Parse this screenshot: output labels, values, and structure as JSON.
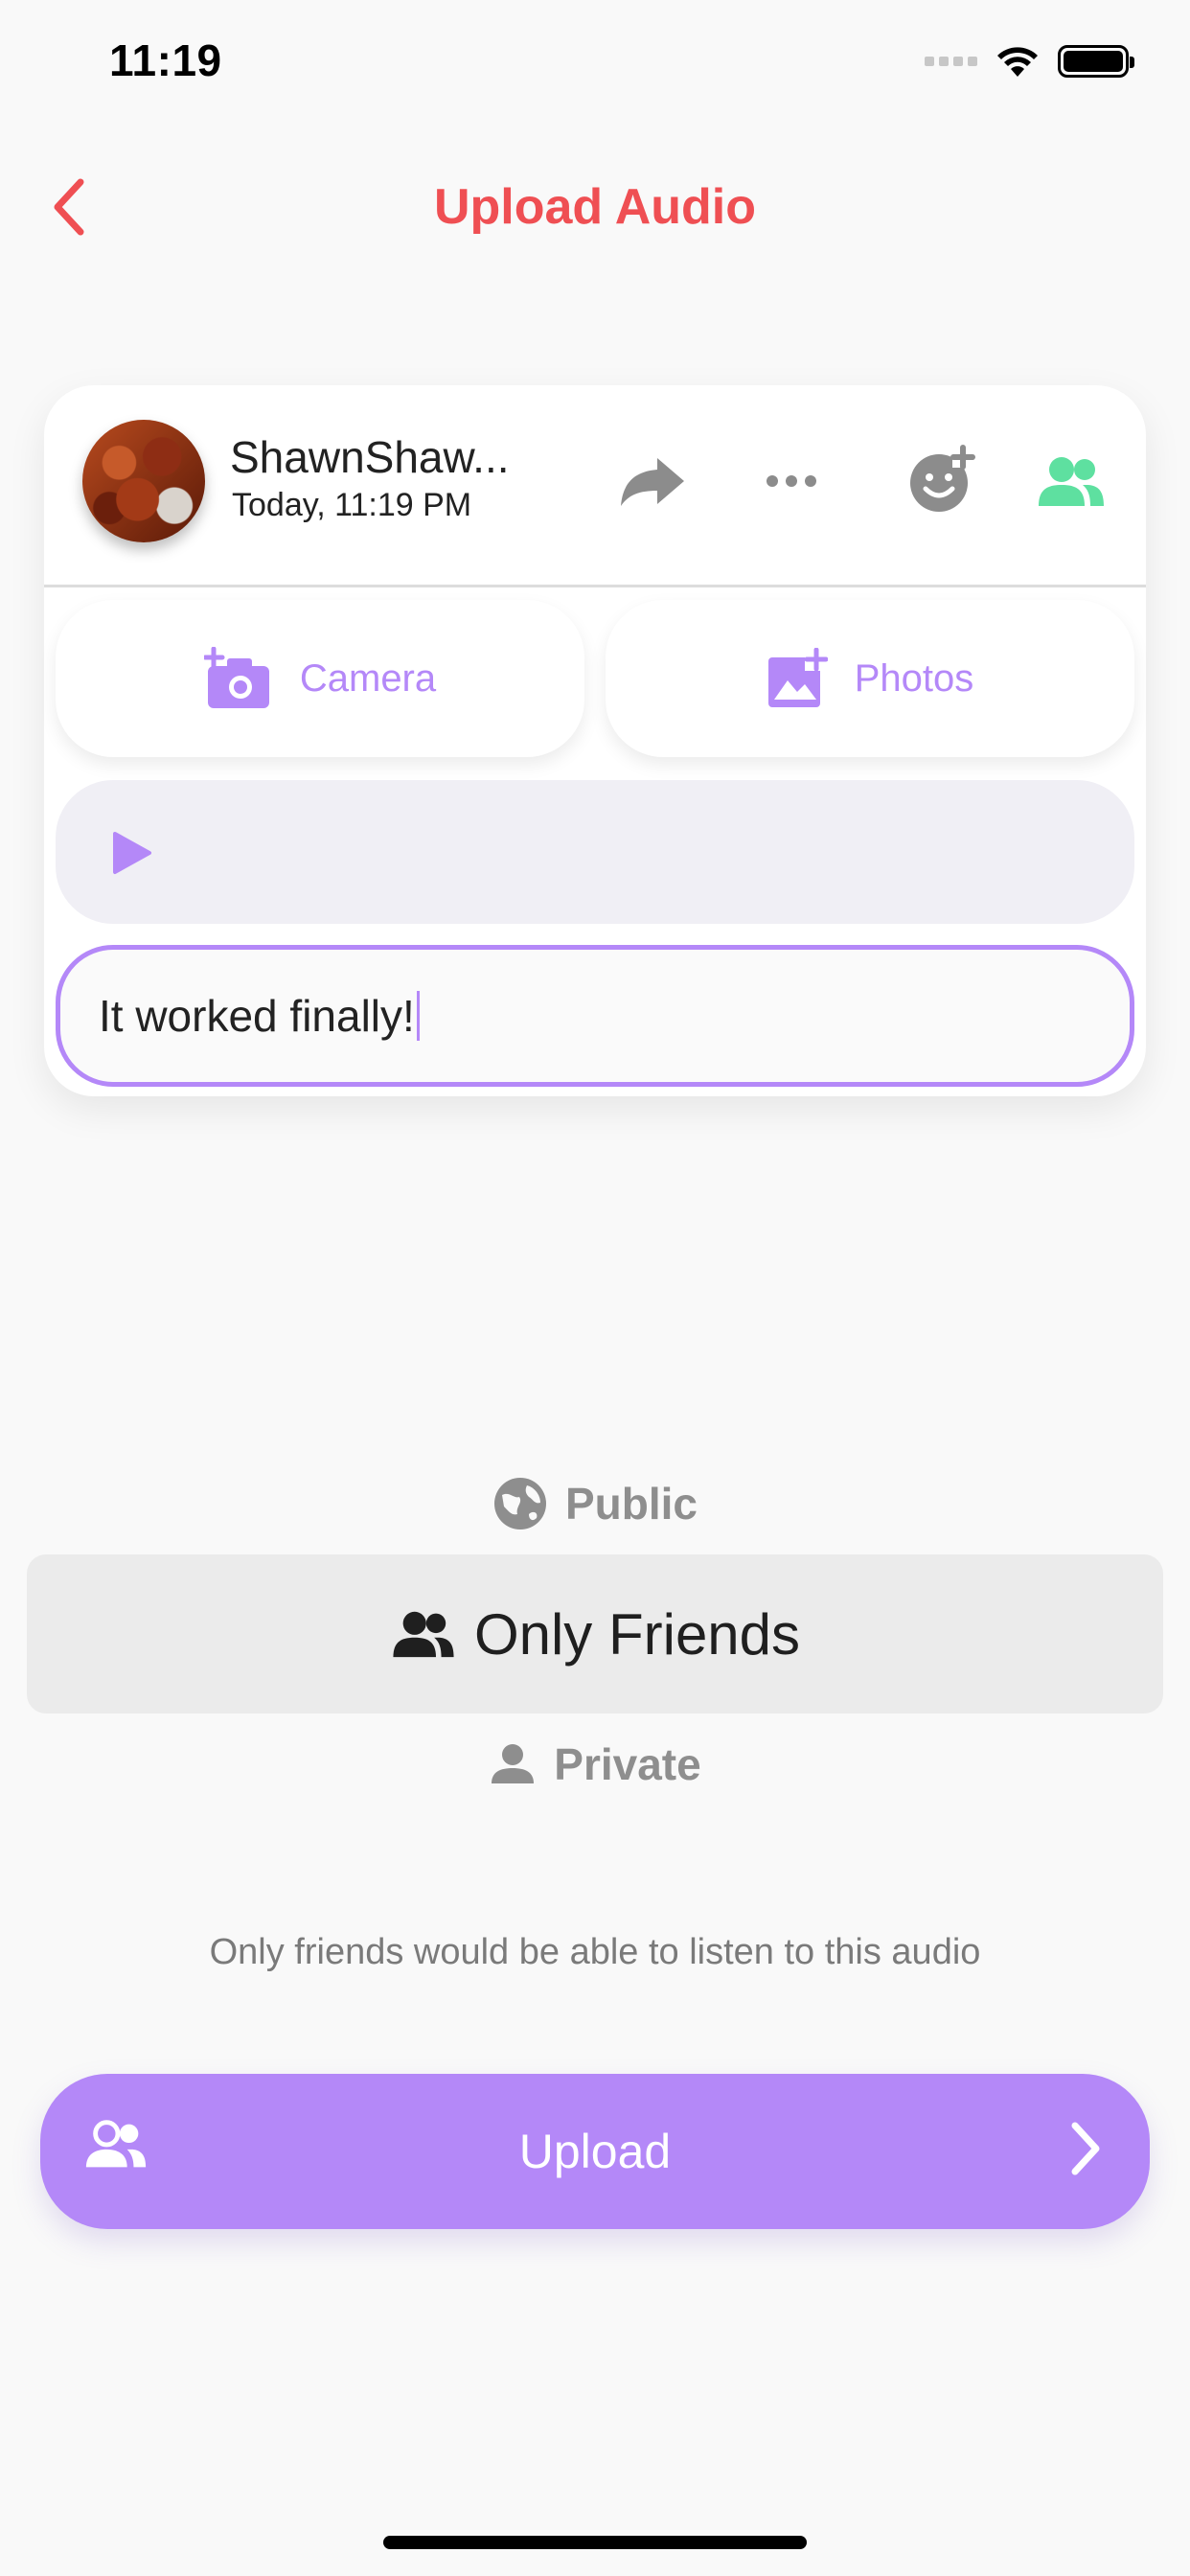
{
  "status_bar": {
    "time": "11:19"
  },
  "header": {
    "title": "Upload Audio"
  },
  "post": {
    "user_name": "ShawnShaw...",
    "time": "Today, 11:19 PM",
    "camera_label": "Camera",
    "photos_label": "Photos",
    "caption_value": "It worked finally!"
  },
  "visibility": {
    "options": [
      {
        "label": "Public",
        "icon": "globe-icon"
      },
      {
        "label": "Only Friends",
        "icon": "friends-icon"
      },
      {
        "label": "Private",
        "icon": "person-icon"
      }
    ],
    "selected": "Only Friends",
    "hint": "Only friends would be able to listen to this audio"
  },
  "upload": {
    "label": "Upload"
  },
  "colors": {
    "accent": "#b488f8",
    "title": "#ef4f53",
    "friends_green": "#5ee0a0",
    "icon_gray": "#8c8c8c"
  }
}
